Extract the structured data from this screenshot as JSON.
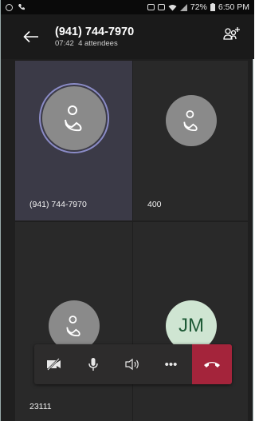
{
  "status_bar": {
    "battery": "72%",
    "time": "6:50 PM"
  },
  "call": {
    "title": "(941) 744-7970",
    "duration": "07:42",
    "attendees": "4 attendees"
  },
  "participants": [
    {
      "label": "(941) 744-7970",
      "avatar_type": "phone-icon",
      "active": true
    },
    {
      "label": "400",
      "avatar_type": "phone-icon",
      "active": false
    },
    {
      "label": "23111",
      "avatar_type": "phone-icon",
      "active": false
    },
    {
      "label": "",
      "initials": "JM",
      "avatar_color": "#cfe5d2"
    }
  ],
  "controls": [
    {
      "name": "camera-off-button",
      "icon": "video-off-icon"
    },
    {
      "name": "microphone-button",
      "icon": "microphone-icon"
    },
    {
      "name": "speaker-button",
      "icon": "speaker-icon"
    },
    {
      "name": "more-options-button",
      "icon": "ellipsis-icon",
      "label": "•••"
    },
    {
      "name": "end-call-button",
      "icon": "hang-up-icon",
      "color": "#a4243b"
    }
  ],
  "colors": {
    "accent_ring": "#8b8cc7",
    "end_call": "#a4243b"
  }
}
